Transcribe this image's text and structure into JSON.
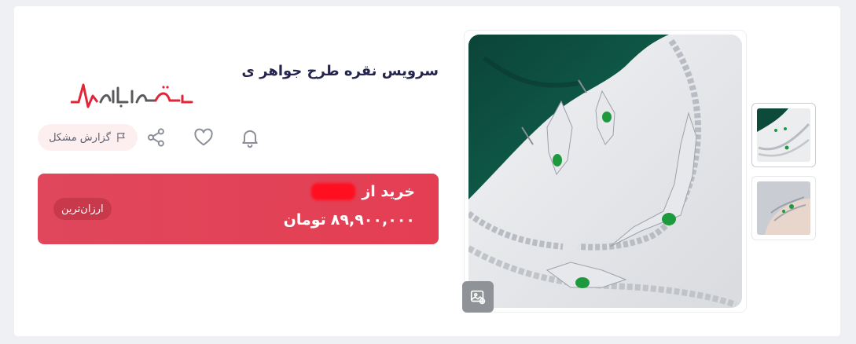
{
  "product": {
    "title": "سرویس نقره طرح جواهر ی",
    "logo_text": "نبض بازار",
    "report_label": "گزارش مشکل"
  },
  "buy": {
    "from_label": "خرید از",
    "price_value": "۸۹,۹۰۰,۰۰۰",
    "currency": "تومان",
    "badge": "ارزان‌ترین"
  },
  "icons": {
    "notify": "bell-icon",
    "favorite": "heart-icon",
    "share": "share-icon",
    "report": "flag-icon",
    "gallery": "image-gallery-icon"
  },
  "colors": {
    "brand_red": "#e0475c",
    "title": "#23254e",
    "badge_bg": "#c7394b",
    "report_bg": "#fdeef0"
  }
}
